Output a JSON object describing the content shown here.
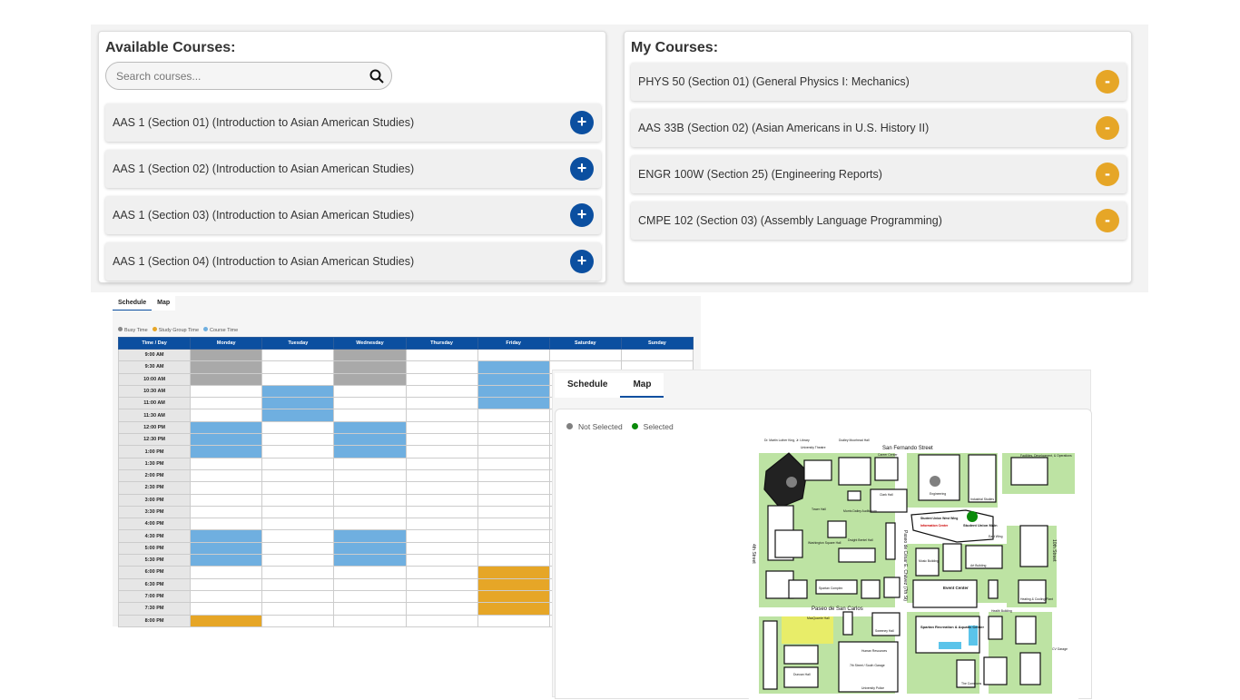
{
  "available": {
    "title": "Available Courses:",
    "search_placeholder": "Search courses...",
    "courses": [
      "AAS 1 (Section 01) (Introduction to Asian American Studies)",
      "AAS 1 (Section 02) (Introduction to Asian American Studies)",
      "AAS 1 (Section 03) (Introduction to Asian American Studies)",
      "AAS 1 (Section 04) (Introduction to Asian American Studies)"
    ],
    "add_label": "+"
  },
  "mine": {
    "title": "My Courses:",
    "courses": [
      "PHYS 50 (Section 01) (General Physics I: Mechanics)",
      "AAS 33B (Section 02) (Asian Americans in U.S. History II)",
      "ENGR 100W (Section 25) (Engineering Reports)",
      "CMPE 102 (Section 03) (Assembly Language Programming)"
    ],
    "remove_label": "-"
  },
  "schedule": {
    "tabs": [
      "Schedule",
      "Map"
    ],
    "legend": [
      "Busy Time",
      "Study Group Time",
      "Course Time"
    ],
    "colors": {
      "busy": "#a9a9a9",
      "study": "#e6a627",
      "course": "#6fafe0"
    },
    "headers": [
      "Time / Day",
      "Monday",
      "Tuesday",
      "Wednesday",
      "Thursday",
      "Friday",
      "Saturday",
      "Sunday"
    ],
    "times": [
      "9:00 AM",
      "9:30 AM",
      "10:00 AM",
      "10:30 AM",
      "11:00 AM",
      "11:30 AM",
      "12:00 PM",
      "12:30 PM",
      "1:00 PM",
      "1:30 PM",
      "2:00 PM",
      "2:30 PM",
      "3:00 PM",
      "3:30 PM",
      "4:00 PM",
      "4:30 PM",
      "5:00 PM",
      "5:30 PM",
      "6:00 PM",
      "6:30 PM",
      "7:00 PM",
      "7:30 PM",
      "8:00 PM"
    ],
    "blocks": [
      {
        "day": "Monday",
        "type": "busy",
        "times": [
          "9:00 AM",
          "9:30 AM",
          "10:00 AM"
        ]
      },
      {
        "day": "Monday",
        "type": "course",
        "times": [
          "12:00 PM",
          "12:30 PM",
          "1:00 PM",
          "4:30 PM",
          "5:00 PM",
          "5:30 PM"
        ]
      },
      {
        "day": "Monday",
        "type": "study",
        "times": [
          "8:00 PM"
        ]
      },
      {
        "day": "Tuesday",
        "type": "course",
        "times": [
          "10:30 AM",
          "11:00 AM",
          "11:30 AM"
        ]
      },
      {
        "day": "Wednesday",
        "type": "busy",
        "times": [
          "9:00 AM",
          "9:30 AM",
          "10:00 AM"
        ]
      },
      {
        "day": "Wednesday",
        "type": "course",
        "times": [
          "12:00 PM",
          "12:30 PM",
          "1:00 PM",
          "4:30 PM",
          "5:00 PM",
          "5:30 PM"
        ]
      },
      {
        "day": "Friday",
        "type": "course",
        "times": [
          "9:30 AM",
          "10:00 AM",
          "10:30 AM",
          "11:00 AM"
        ]
      },
      {
        "day": "Friday",
        "type": "study",
        "times": [
          "6:00 PM",
          "6:30 PM",
          "7:00 PM",
          "7:30 PM"
        ]
      }
    ]
  },
  "map": {
    "tabs": [
      "Schedule",
      "Map"
    ],
    "legend": [
      "Not Selected",
      "Selected"
    ],
    "labels": {
      "library": "Dr. Martin Luther King, Jr. Library",
      "theatre": "University Theatre",
      "dudley": "Dudley Moorhead Hall",
      "sanfernando": "San Fernando Street",
      "career": "Career Center",
      "engineering": "Engineering",
      "industrial": "Industrial Studies",
      "clark": "Clark Hall",
      "suwest": "Student Union West Wing",
      "info": "Information Center",
      "sumain": "Student Union Main",
      "eastwing": "East Wing",
      "tower": "Tower Hall",
      "morris": "Morris Dailey Auditorium",
      "washington": "Washington Square Hall",
      "dwight": "Dwight Bentel Hall",
      "music": "Music Building",
      "art": "Art Building",
      "fourth": "4th Street",
      "tenth": "10th Street",
      "chavez": "Paseo de César E. Chávez (7th St)",
      "sancarlos": "Paseo de San Carlos",
      "event": "Event Center",
      "spartancomplex": "Spartan Complex",
      "src": "Spartan Recreation & Aquatic Center",
      "sweeney": "Sweeney Hall",
      "macquarrie": "MacQuarrie Hall",
      "duncan": "Duncan Hall",
      "garage": "7th Street / South Garage",
      "hr": "Human Resources",
      "police": "University Police",
      "health": "Health Building",
      "commons": "The Commons",
      "cvgarage": "CV Garage",
      "fdo": "Facilities, Development, & Operations",
      "heating": "Heating & Cooling Plant"
    },
    "colors": {
      "not_selected": "#808080",
      "selected": "#0a8a0a",
      "grass": "#bde3a3"
    }
  }
}
